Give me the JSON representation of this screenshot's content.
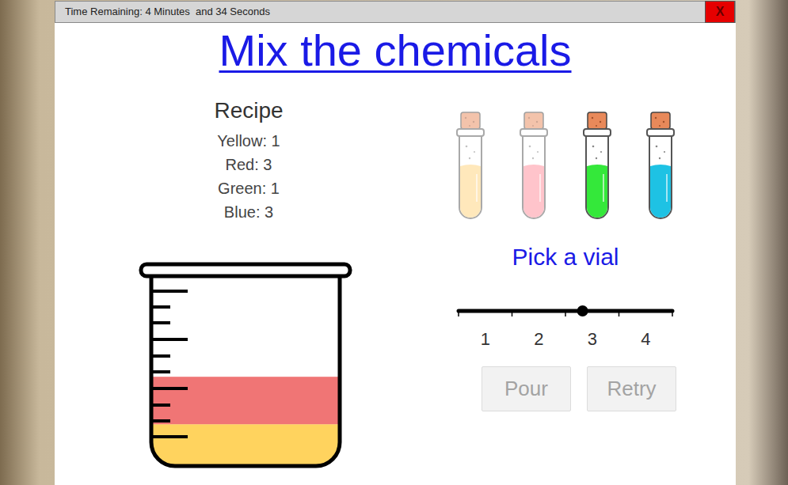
{
  "window": {
    "title": "Time Remaining: 4 Minutes  and 34 Seconds",
    "close_button": "X"
  },
  "heading": "Mix the chemicals",
  "recipe": {
    "title": "Recipe",
    "items": [
      "Yellow: 1",
      "Red: 3",
      "Green: 1",
      "Blue: 3"
    ]
  },
  "beaker": {
    "layers": [
      {
        "level": 0.22,
        "color": "#ffd35e"
      },
      {
        "level": 0.25,
        "color": "#f07575"
      }
    ]
  },
  "vials": [
    {
      "color": "#ffd27a",
      "disabled": true
    },
    {
      "color": "#ff8a98",
      "disabled": true
    },
    {
      "color": "#34e83a",
      "disabled": false
    },
    {
      "color": "#1ec2e4",
      "disabled": false
    }
  ],
  "prompt": "Pick a vial",
  "slider": {
    "level": 0.58,
    "ticks": [
      "1",
      "2",
      "3",
      "4"
    ]
  },
  "buttons": [
    {
      "label": "Pour",
      "disabled": true
    },
    {
      "label": "Retry",
      "disabled": true
    }
  ]
}
